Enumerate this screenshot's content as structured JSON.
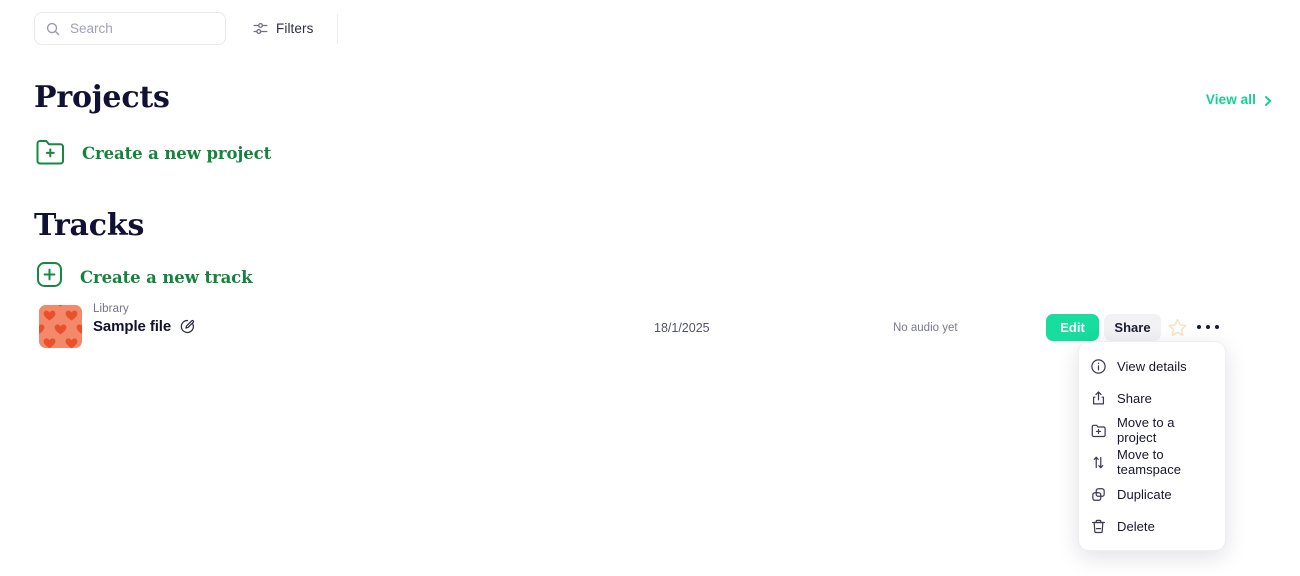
{
  "topbar": {
    "search": {
      "placeholder": "Search",
      "value": "",
      "icon": "search-icon"
    },
    "filters": {
      "label": "Filters",
      "icon": "sliders-icon"
    }
  },
  "projects": {
    "title": "Projects",
    "view_all": {
      "label": "View all",
      "icon": "chevron-right-icon"
    },
    "create": {
      "label": "Create a new project",
      "icon": "folder-plus-icon"
    }
  },
  "tracks": {
    "title": "Tracks",
    "create": {
      "label": "Create a new track",
      "icon": "square-plus-icon"
    },
    "rows": [
      {
        "thumbnail": "heart-pattern-thumbnail",
        "source": "Library",
        "name": "Sample file",
        "rename_icon": "pencil-circle-icon",
        "date": "18/1/2025",
        "audio_status": "No audio yet",
        "edit_label": "Edit",
        "share_label": "Share",
        "star_icon": "star-outline-icon",
        "more_icon": "ellipsis-icon"
      }
    ]
  },
  "context_menu": {
    "items": [
      {
        "label": "View details",
        "icon": "info-circle-icon"
      },
      {
        "label": "Share",
        "icon": "share-upload-icon"
      },
      {
        "label": "Move to a project",
        "icon": "folder-plus-icon"
      },
      {
        "label": "Move to teamspace",
        "icon": "arrows-up-down-icon"
      },
      {
        "label": "Duplicate",
        "icon": "copy-icon"
      },
      {
        "label": "Delete",
        "icon": "trash-icon"
      }
    ]
  },
  "colors": {
    "accent_mint": "#17dd9e",
    "accent_green": "#15833d",
    "heading": "#111133",
    "thumb_orange": "#e8522a",
    "thumb_bg": "#f4886a",
    "star": "#fbe0bd"
  }
}
